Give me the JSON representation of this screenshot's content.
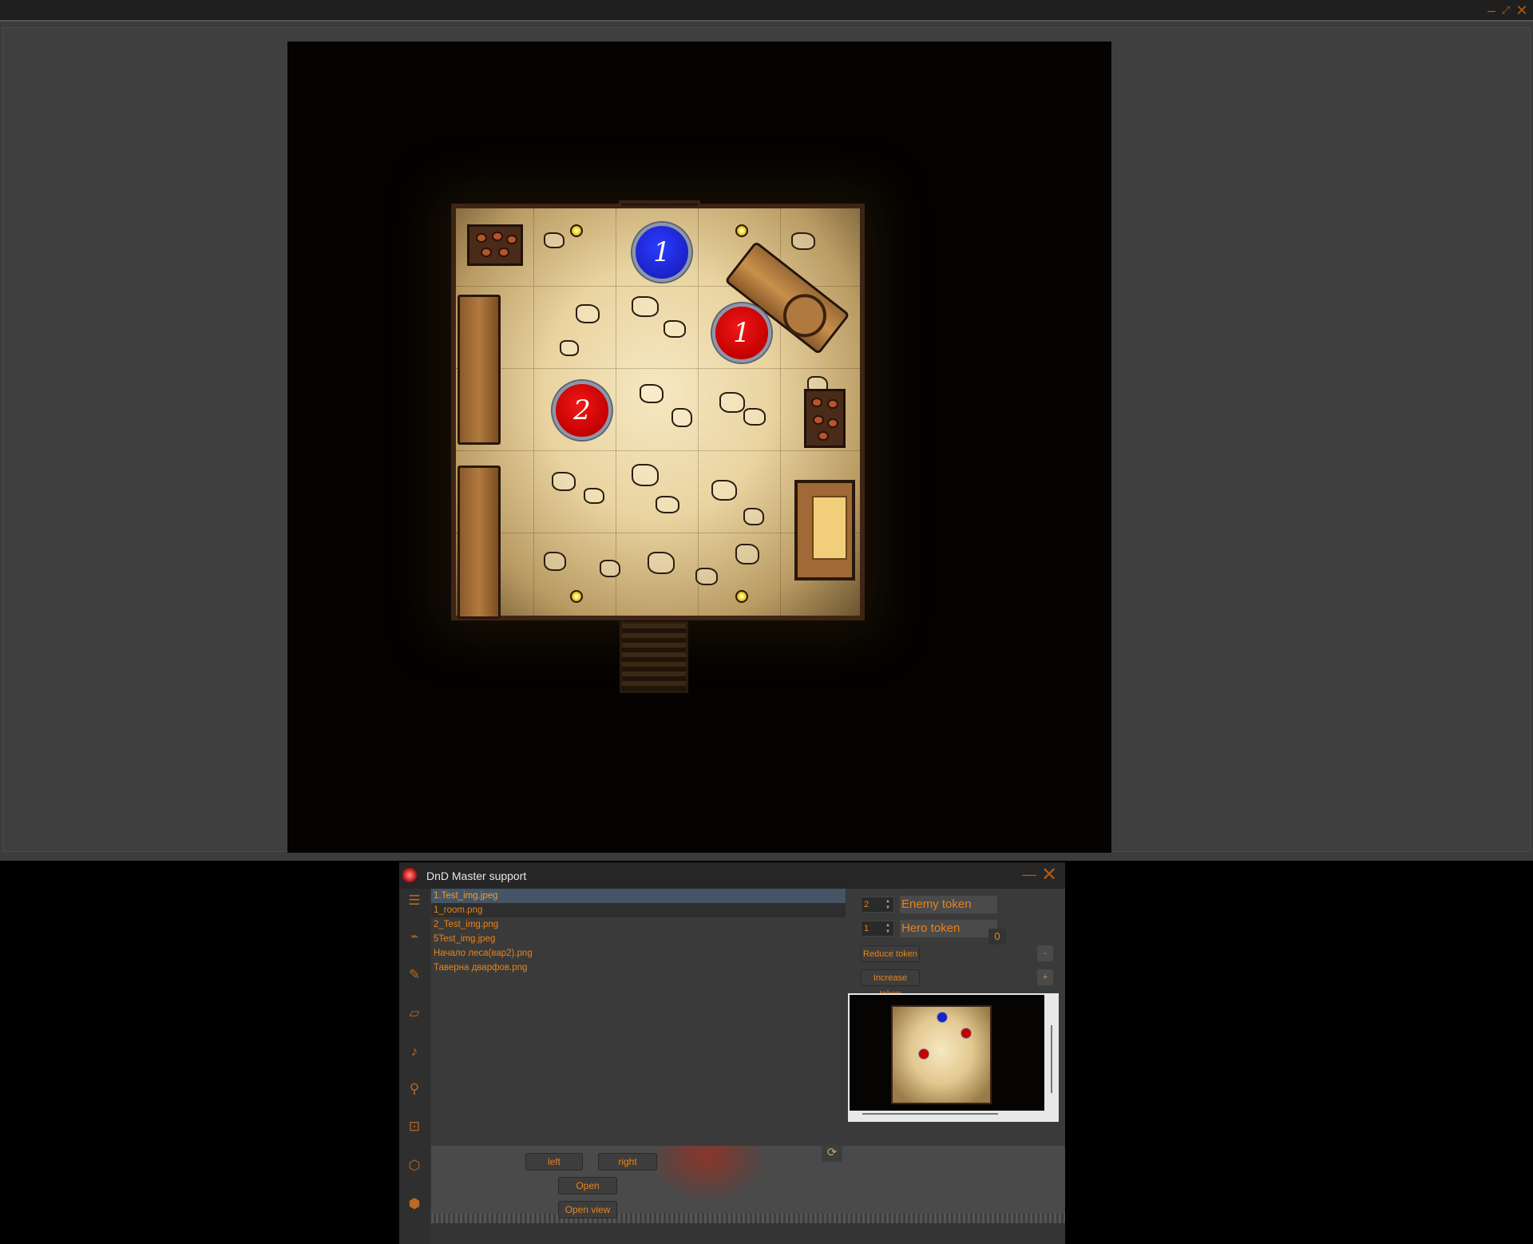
{
  "viewer": {
    "title_buttons": {
      "minimize_icon": "minimize-icon",
      "restore_icon": "restore-icon",
      "close_icon": "close-icon"
    },
    "tokens": [
      {
        "type": "hero",
        "number": "1",
        "color": "#1b22c8"
      },
      {
        "type": "enemy",
        "number": "1",
        "color": "#c40000"
      },
      {
        "type": "enemy",
        "number": "2",
        "color": "#c40000"
      }
    ]
  },
  "control": {
    "title": "DnD Master support",
    "app_icon": "d20-dice-icon",
    "sidebar_icons": [
      "list-icon",
      "pulse-icon",
      "ruler-icon",
      "scroll-icon",
      "music-note-icon",
      "magic-wand-icon",
      "edit-icon",
      "dice-icon",
      "d20-icon"
    ],
    "files": [
      "1.Test_img.jpeg",
      "1_room.png",
      "2_Test_img.png",
      "5Test_img.jpeg",
      "Начало леса(вар2).png",
      "Таверна дварфов.png"
    ],
    "selected_file_index": 0,
    "buttons": {
      "left": "left",
      "right": "right",
      "open": "Open",
      "open_view": "Open view",
      "reduce_token": "Reduce token",
      "increase_token": "Increase token",
      "minus": "-",
      "plus": "+"
    },
    "enemy_token": {
      "count": "2",
      "label": "Enemy token"
    },
    "hero_token": {
      "count": "1",
      "label": "Hero token"
    },
    "counter_value": "0",
    "accent_color": "#e8831a"
  }
}
